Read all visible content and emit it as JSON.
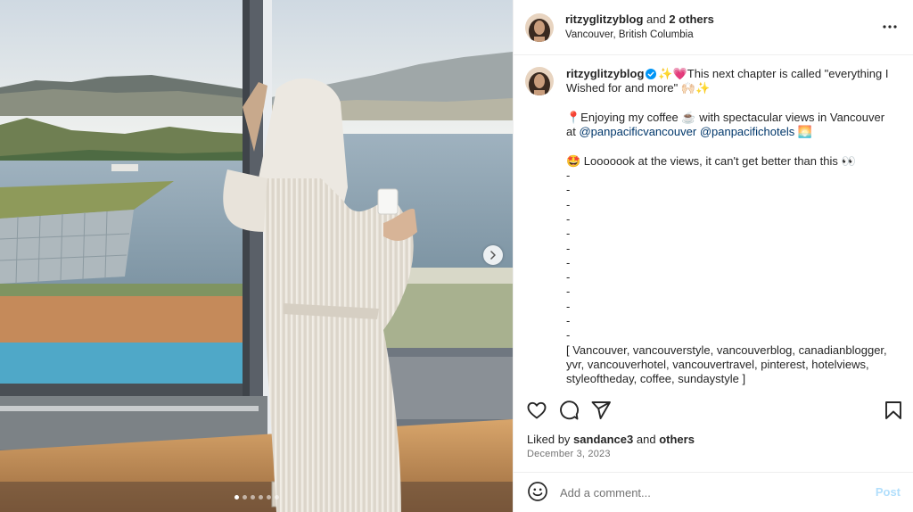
{
  "post": {
    "author": "ritzyglitzyblog",
    "collab_joiner": "and",
    "collab_others": "2 others",
    "location": "Vancouver, British Columbia"
  },
  "media": {
    "slide_count": 6,
    "active_slide": 1,
    "next_icon": "chevron-right-icon"
  },
  "caption": {
    "username": "ritzyglitzyblog",
    "line1": "✨💗This next chapter is called \"everything I Wished for and more\" 🙌🏻✨",
    "line2_pre": "📍Enjoying my coffee ☕ with spectacular views in Vancouver at ",
    "mention1": "@panpacificvancouver",
    "mention2": "@panpacifichotels",
    "line2_post": " 🌅",
    "line3": "🤩 Looooook at the views, it can't get better than this 👀",
    "dashes": [
      "-",
      "-",
      "-",
      "-",
      "-",
      "-",
      "-",
      "-",
      "-",
      "-",
      "-",
      "-"
    ],
    "hashtags": "[ Vancouver, vancouverstyle, vancouverblog, canadianblogger, yvr, vancouverhotel, vancouvertravel, pinterest, hotelviews, styleoftheday, coffee, sundaystyle ]"
  },
  "engagement": {
    "liked_by_label": "Liked by",
    "liked_by_user": "sandance3",
    "and_label": "and",
    "others_label": "others",
    "date": "December 3, 2023"
  },
  "comment": {
    "placeholder": "Add a comment...",
    "post_label": "Post"
  },
  "colors": {
    "mention": "#00376b",
    "verified": "#0095f6",
    "post_disabled": "#b2dffc",
    "muted": "#737373"
  }
}
